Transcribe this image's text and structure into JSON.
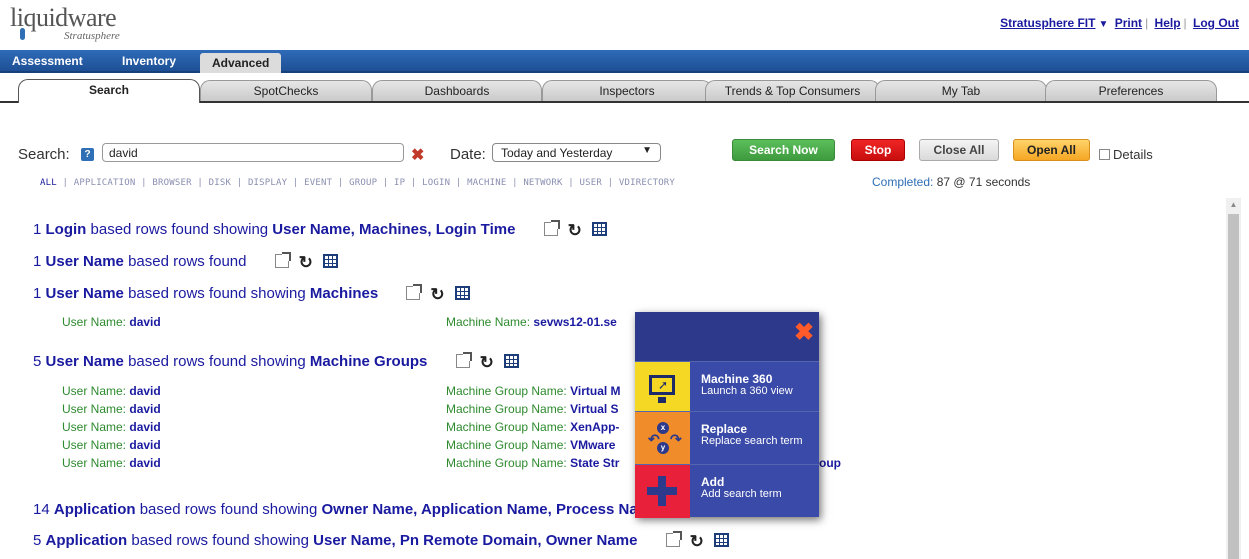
{
  "brand": {
    "name": "liquidware",
    "sub": "Stratusphere"
  },
  "top_links": {
    "product": "Stratusphere FIT",
    "print": "Print",
    "help": "Help",
    "logout": "Log Out"
  },
  "main_nav": {
    "assessment": "Assessment",
    "inventory": "Inventory",
    "advanced": "Advanced"
  },
  "sub_tabs": [
    "Search",
    "SpotChecks",
    "Dashboards",
    "Inspectors",
    "Trends & Top Consumers",
    "My Tab",
    "Preferences"
  ],
  "search": {
    "label": "Search:",
    "help": "?",
    "value": "david",
    "clear": "✖",
    "date_label": "Date:",
    "date_value": "Today and Yesterday",
    "search_now": "Search Now",
    "stop": "Stop",
    "close_all": "Close All",
    "open_all": "Open All",
    "details": "Details"
  },
  "filters": [
    "ALL",
    "APPLICATION",
    "BROWSER",
    "DISK",
    "DISPLAY",
    "EVENT",
    "GROUP",
    "IP",
    "LOGIN",
    "MACHINE",
    "NETWORK",
    "USER",
    "VDIRECTORY"
  ],
  "completed": {
    "label": "Completed:",
    "value": "87 @ 71 seconds"
  },
  "results": {
    "r1": {
      "count": "1",
      "type": "Login",
      "mid": " based rows found showing ",
      "fields": "User Name, Machines, Login Time"
    },
    "r2": {
      "count": "1",
      "type": "User Name",
      "mid": " based rows found",
      "fields": ""
    },
    "r3": {
      "count": "1",
      "type": "User Name",
      "mid": " based rows found showing ",
      "fields": "Machines"
    },
    "r3_row": {
      "k1": "User Name:",
      "v1": "david",
      "k2": "Machine Name:",
      "v2": "sevws12-01.se"
    },
    "r4": {
      "count": "5",
      "type": "User Name",
      "mid": " based rows found showing ",
      "fields": "Machine Groups"
    },
    "r4_rows": [
      {
        "k1": "User Name:",
        "v1": "david",
        "k2": "Machine Group Name:",
        "v2": "Virtual M"
      },
      {
        "k1": "User Name:",
        "v1": "david",
        "k2": "Machine Group Name:",
        "v2": "Virtual S"
      },
      {
        "k1": "User Name:",
        "v1": "david",
        "k2": "Machine Group Name:",
        "v2": "XenApp-"
      },
      {
        "k1": "User Name:",
        "v1": "david",
        "k2": "Machine Group Name:",
        "v2": "VMware"
      },
      {
        "k1": "User Name:",
        "v1": "david",
        "k2": "Machine Group Name:",
        "v2": "State Str",
        "tail": "oup"
      }
    ],
    "r5": {
      "count": "14",
      "type": "Application",
      "mid": " based rows found showing ",
      "fields": "Owner Name, Application Name, Process Name"
    },
    "r6": {
      "count": "5",
      "type": "Application",
      "mid": " based rows found showing ",
      "fields": "User Name, Pn Remote Domain, Owner Name"
    }
  },
  "popup": {
    "close": "✖",
    "items": [
      {
        "title": "Machine 360",
        "desc": "Launch a 360 view"
      },
      {
        "title": "Replace",
        "desc": "Replace search term"
      },
      {
        "title": "Add",
        "desc": "Add search term"
      }
    ]
  }
}
